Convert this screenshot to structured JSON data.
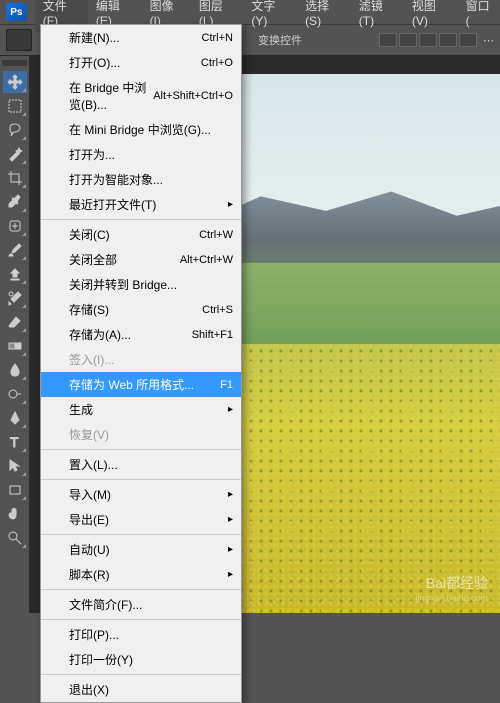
{
  "app_icon": "Ps",
  "menubar": [
    {
      "label": "文件(F)",
      "active": true
    },
    {
      "label": "编辑(E)"
    },
    {
      "label": "图像(I)"
    },
    {
      "label": "图层(L)"
    },
    {
      "label": "文字(Y)"
    },
    {
      "label": "选择(S)"
    },
    {
      "label": "滤镜(T)"
    },
    {
      "label": "视图(V)"
    },
    {
      "label": "窗口("
    }
  ],
  "options_bar": {
    "transform_label": "变换控件"
  },
  "dropdown": {
    "items": [
      {
        "label": "新建(N)...",
        "shortcut": "Ctrl+N"
      },
      {
        "label": "打开(O)...",
        "shortcut": "Ctrl+O"
      },
      {
        "label": "在 Bridge 中浏览(B)...",
        "shortcut": "Alt+Shift+Ctrl+O"
      },
      {
        "label": "在 Mini Bridge 中浏览(G)..."
      },
      {
        "label": "打开为...",
        "shortcut": ""
      },
      {
        "label": "打开为智能对象..."
      },
      {
        "label": "最近打开文件(T)",
        "submenu": true
      },
      {
        "sep": true
      },
      {
        "label": "关闭(C)",
        "shortcut": "Ctrl+W"
      },
      {
        "label": "关闭全部",
        "shortcut": "Alt+Ctrl+W"
      },
      {
        "label": "关闭并转到 Bridge...",
        "shortcut": ""
      },
      {
        "label": "存储(S)",
        "shortcut": "Ctrl+S"
      },
      {
        "label": "存储为(A)...",
        "shortcut": "Shift+F1"
      },
      {
        "label": "签入(I)...",
        "disabled": true
      },
      {
        "label": "存储为 Web 所用格式...",
        "shortcut": "F1",
        "highlighted": true
      },
      {
        "label": "生成",
        "submenu": true
      },
      {
        "label": "恢复(V)",
        "disabled": true,
        "shortcut": ""
      },
      {
        "sep": true
      },
      {
        "label": "置入(L)..."
      },
      {
        "sep": true
      },
      {
        "label": "导入(M)",
        "submenu": true
      },
      {
        "label": "导出(E)",
        "submenu": true
      },
      {
        "sep": true
      },
      {
        "label": "自动(U)",
        "submenu": true
      },
      {
        "label": "脚本(R)",
        "submenu": true
      },
      {
        "sep": true
      },
      {
        "label": "文件简介(F)...",
        "shortcut": ""
      },
      {
        "sep": true
      },
      {
        "label": "打印(P)...",
        "shortcut": ""
      },
      {
        "label": "打印一份(Y)",
        "shortcut": ""
      },
      {
        "sep": true
      },
      {
        "label": "退出(X)",
        "shortcut": ""
      }
    ]
  },
  "watermark": {
    "main": "Bai都经验",
    "sub": "jingyan.baidu.com"
  }
}
